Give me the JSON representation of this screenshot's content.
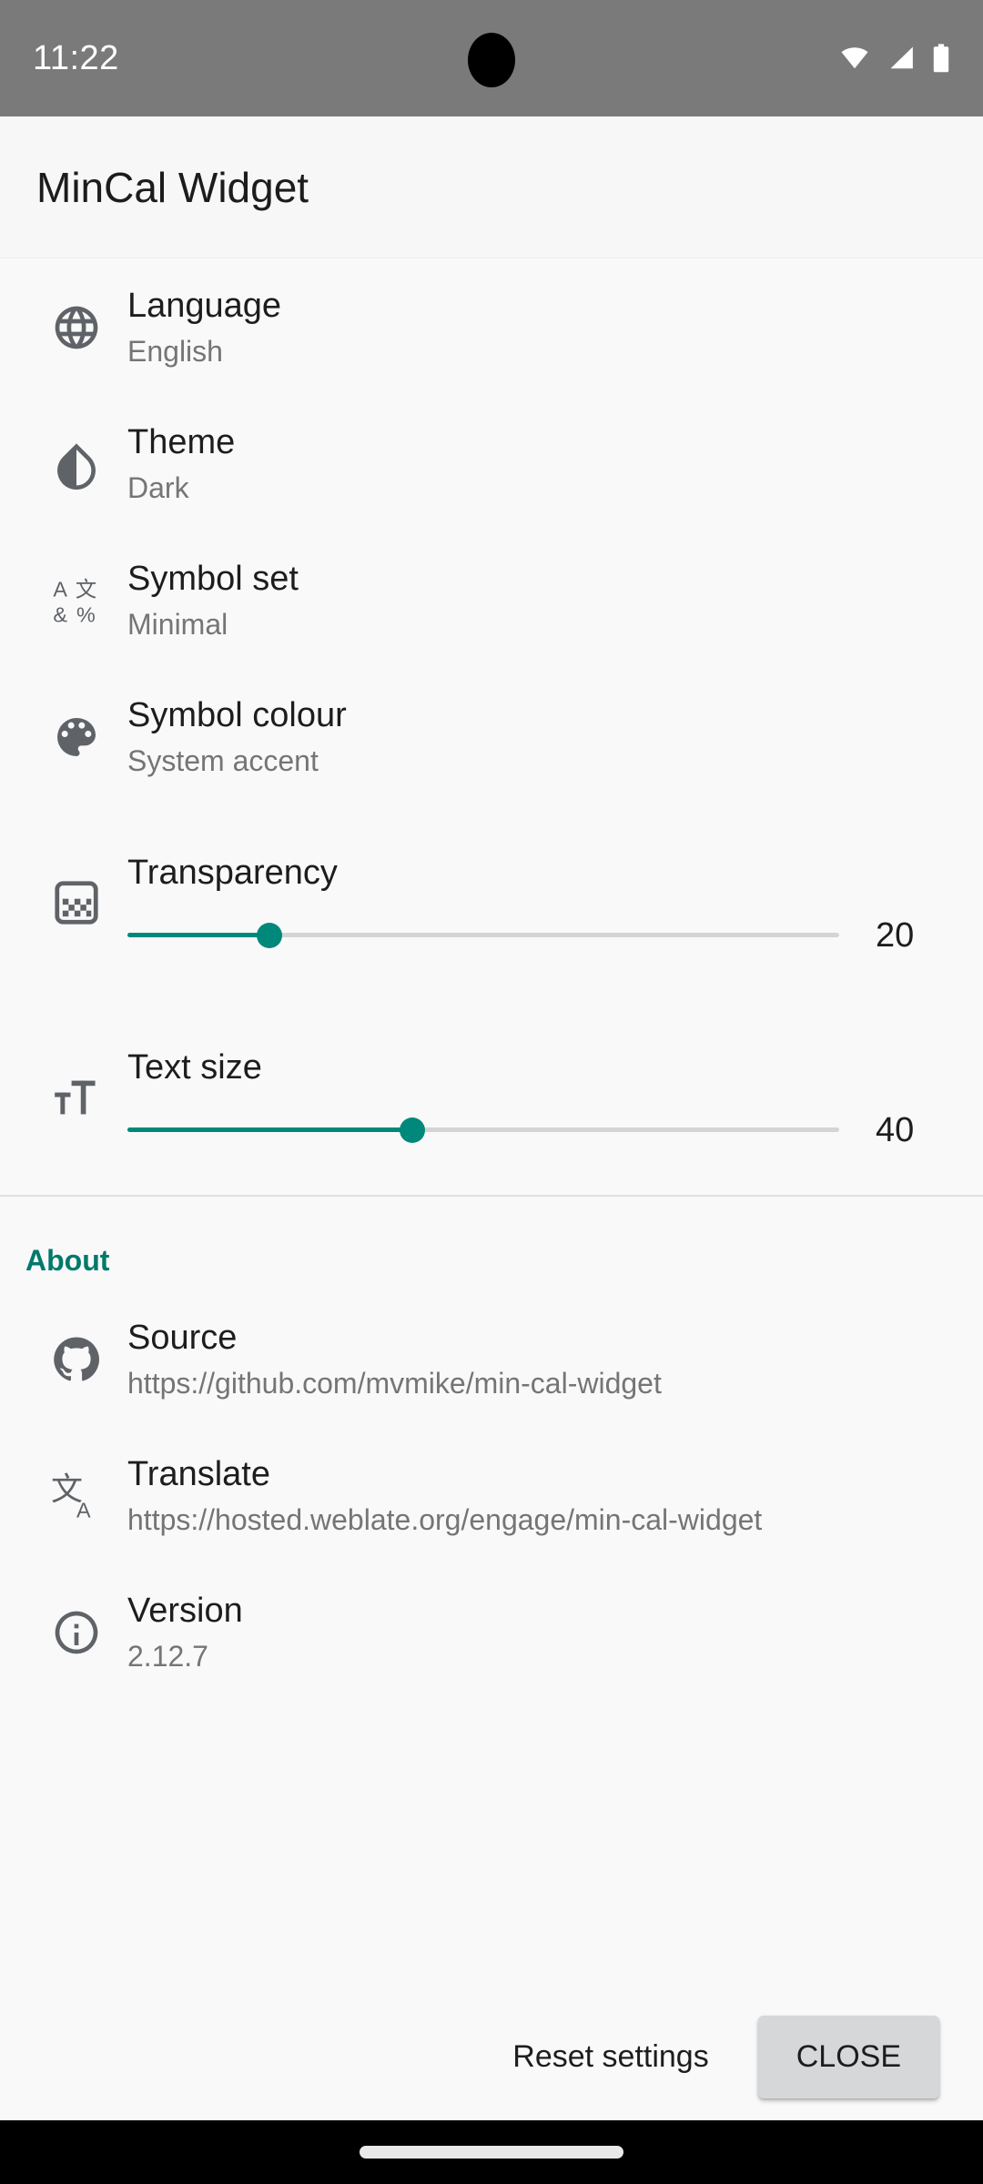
{
  "status_bar": {
    "time": "11:22",
    "icons": [
      "wifi-icon",
      "signal-icon",
      "battery-icon"
    ]
  },
  "app": {
    "title": "MinCal Widget"
  },
  "settings": {
    "items": [
      {
        "icon": "globe-icon",
        "title": "Language",
        "value": "English"
      },
      {
        "icon": "contrast-droplet-icon",
        "title": "Theme",
        "value": "Dark"
      },
      {
        "icon": "symbol-characters-icon",
        "title": "Symbol set",
        "value": "Minimal"
      },
      {
        "icon": "palette-icon",
        "title": "Symbol colour",
        "value": "System accent"
      }
    ],
    "sliders": [
      {
        "icon": "transparency-checker-icon",
        "label": "Transparency",
        "value": "20",
        "percent": 20,
        "min": 0,
        "max": 100
      },
      {
        "icon": "text-size-icon",
        "label": "Text size",
        "value": "40",
        "percent": 40,
        "min": 0,
        "max": 100
      }
    ]
  },
  "about": {
    "header": "About",
    "items": [
      {
        "icon": "github-icon",
        "title": "Source",
        "value": "https://github.com/mvmike/min-cal-widget"
      },
      {
        "icon": "translate-icon",
        "title": "Translate",
        "value": "https://hosted.weblate.org/engage/min-cal-widget"
      },
      {
        "icon": "info-icon",
        "title": "Version",
        "value": "2.12.7"
      }
    ]
  },
  "footer": {
    "reset_label": "Reset settings",
    "close_label": "CLOSE"
  },
  "colors": {
    "accent": "#00897b",
    "section_header": "#00796b",
    "background": "#f9f9f9",
    "title_bar": "#f7f7f7",
    "status_bar": "#7a7a7a",
    "primary_text": "#1d1d1d",
    "secondary_text": "#757575"
  }
}
